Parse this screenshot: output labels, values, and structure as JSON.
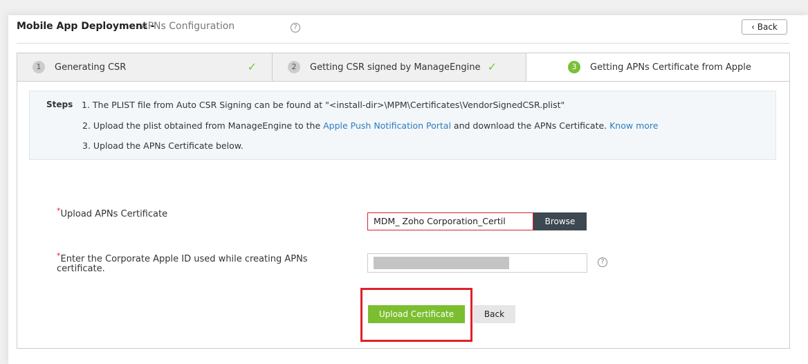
{
  "header": {
    "title_strong": "Mobile App Deployment -",
    "title_light": "APNs Configuration",
    "help_symbol": "?",
    "back_label": "‹ Back"
  },
  "wizard": {
    "tabs": [
      {
        "number": "1",
        "label": "Generating CSR",
        "check": "✓"
      },
      {
        "number": "2",
        "label": "Getting CSR signed by ManageEngine",
        "check": "✓"
      },
      {
        "number": "3",
        "label": "Getting APNs Certificate from Apple"
      }
    ]
  },
  "steps": {
    "label": "Steps",
    "line1": "1. The PLIST file from Auto CSR Signing can be found at \"<install-dir>\\MPM\\Certificates\\VendorSignedCSR.plist\"",
    "line2_pre": "2. Upload the plist obtained from ManageEngine to the ",
    "line2_link": "Apple Push Notification Portal",
    "line2_mid": " and download the APNs Certificate. ",
    "line2_link2": "Know more",
    "line3": "3. Upload the APNs Certificate below."
  },
  "form": {
    "required_mark": "*",
    "upload_label": "Upload APNs Certificate",
    "file_value": "MDM_ Zoho Corporation_Certil",
    "browse_label": "Browse",
    "appleid_label": "Enter the Corporate Apple ID used while creating APNs certificate.",
    "help_symbol": "?",
    "upload_button": "Upload Certificate",
    "back_button": "Back"
  },
  "colors": {
    "accent_green": "#7cbe31",
    "link_blue": "#2f7bbd",
    "required_red": "#d9232e",
    "highlight_red": "#e0202a"
  }
}
